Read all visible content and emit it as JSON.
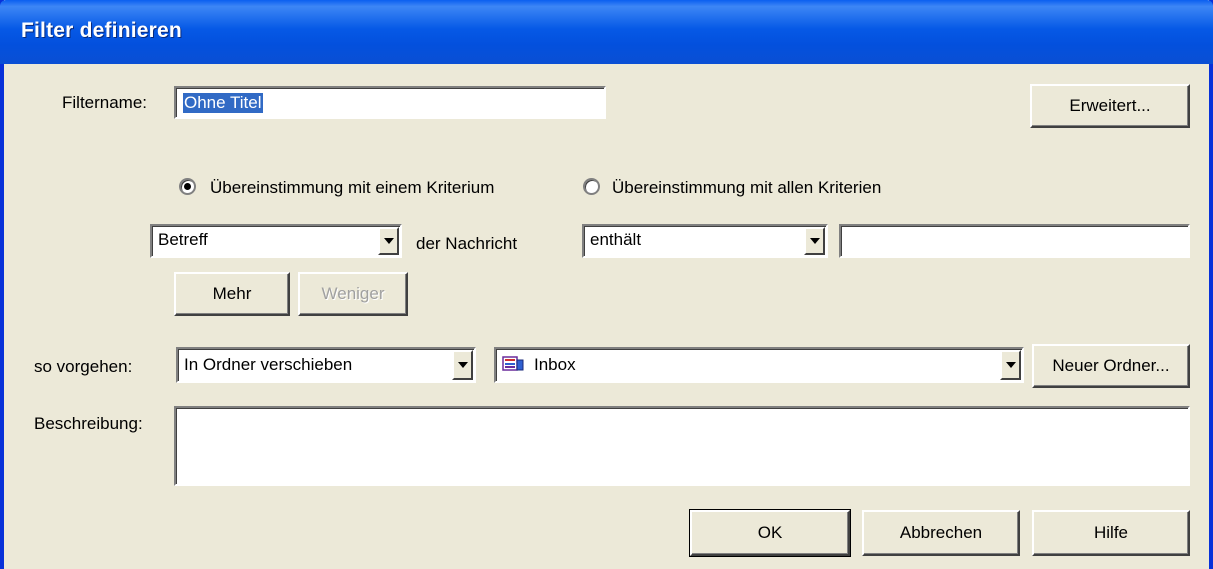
{
  "window": {
    "title": "Filter definieren"
  },
  "filtername": {
    "label": "Filtername:",
    "value": "Ohne Titel"
  },
  "buttons": {
    "erweitert": "Erweitert...",
    "mehr": "Mehr",
    "weniger": "Weniger",
    "neuer_ordner": "Neuer Ordner...",
    "ok": "OK",
    "abbrechen": "Abbrechen",
    "hilfe": "Hilfe"
  },
  "match": {
    "option_any": "Übereinstimmung mit einem Kriterium",
    "option_all": "Übereinstimmung mit allen Kriterien",
    "selected": "option_any"
  },
  "criterion": {
    "field": "Betreff",
    "field_suffix": "der Nachricht",
    "operator": "enthält",
    "value": ""
  },
  "action": {
    "label": "so vorgehen:",
    "type": "In Ordner verschieben",
    "folder_icon": "inbox-folder-icon",
    "folder": "Inbox"
  },
  "description": {
    "label": "Beschreibung:",
    "value": ""
  },
  "colors": {
    "titlebar": "#0055e5",
    "face": "#ece9d8",
    "selection": "#316ac5"
  }
}
